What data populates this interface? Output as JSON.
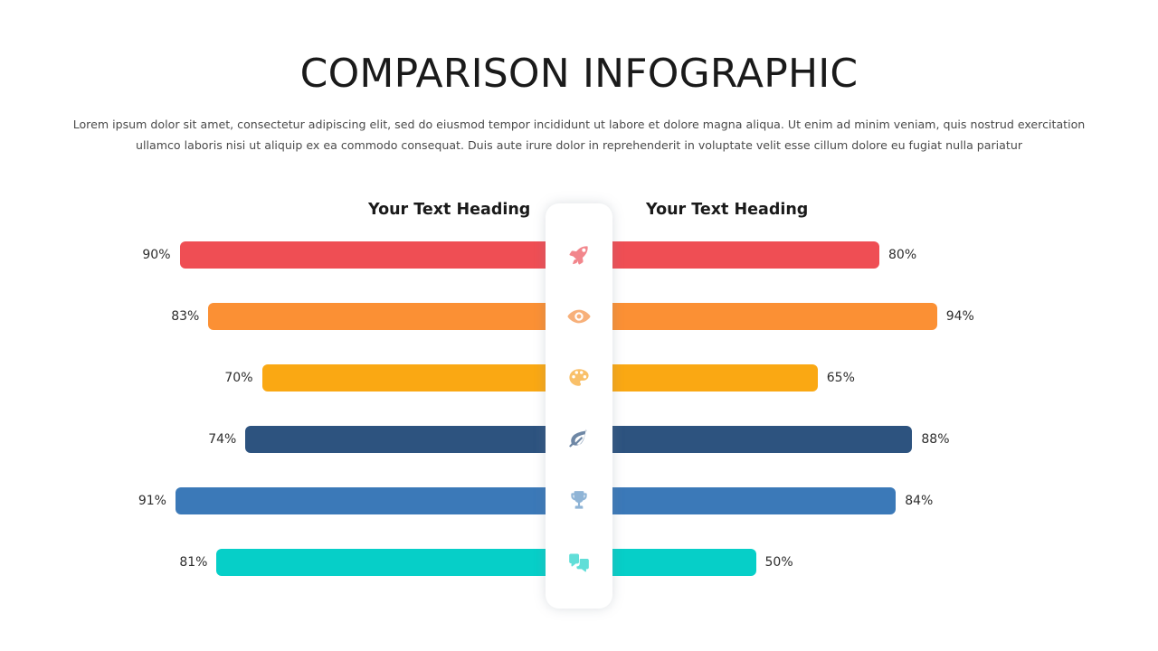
{
  "header": {
    "title": "COMPARISON INFOGRAPHIC",
    "paragraph": "Lorem ipsum dolor sit amet, consectetur adipiscing elit, sed do eiusmod tempor incididunt  ut labore et dolore magna aliqua. Ut enim ad minim veniam, quis  nostrud  exercitation ullamco laboris nisi ut aliquip ex ea commodo  consequat.  Duis aute irure dolor in reprehenderit in voluptate  velit esse cillum  dolore  eu fugiat nulla pariatur"
  },
  "columns": {
    "left_heading": "Your Text Heading",
    "right_heading": "Your Text Heading"
  },
  "chart_data": {
    "type": "bar",
    "title": "COMPARISON INFOGRAPHIC",
    "orientation": "horizontal-diverging",
    "xlabel": "",
    "ylabel": "",
    "xlim": [
      0,
      100
    ],
    "grid": false,
    "legend_position": "none",
    "categories": [
      "rocket",
      "eye",
      "palette",
      "leaf",
      "trophy",
      "chat"
    ],
    "series": [
      {
        "name": "Your Text Heading",
        "side": "left",
        "values": [
          90,
          83,
          70,
          74,
          91,
          81
        ]
      },
      {
        "name": "Your Text Heading",
        "side": "right",
        "values": [
          80,
          94,
          65,
          88,
          84,
          50
        ]
      }
    ],
    "labels": {
      "left": [
        "90%",
        "83%",
        "70%",
        "74%",
        "91%",
        "81%"
      ],
      "right": [
        "80%",
        "94%",
        "65%",
        "88%",
        "84%",
        "50%"
      ]
    },
    "colors": [
      "#ef4e54",
      "#fb9034",
      "#faa813",
      "#2d537f",
      "#3b79b8",
      "#06cfc8"
    ],
    "icon_colors": [
      "#f2868c",
      "#f7b07a",
      "#f9c069",
      "#6e87a5",
      "#8fb4d6",
      "#61ded8"
    ],
    "icon_names": [
      "rocket-icon",
      "eye-icon",
      "palette-icon",
      "leaf-icon",
      "trophy-icon",
      "chat-icon"
    ]
  }
}
